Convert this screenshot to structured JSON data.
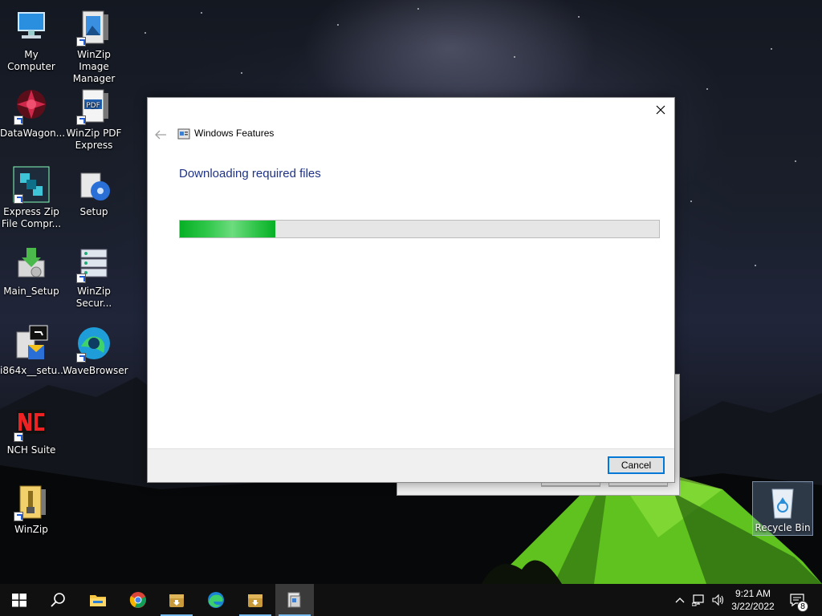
{
  "desktop": {
    "icons": [
      {
        "label": "My Computer",
        "icon": "computer-icon"
      },
      {
        "label": "WinZip Image Manager",
        "icon": "winzip-image-manager-icon"
      },
      {
        "label": "DataWagon...",
        "icon": "datawagon-icon"
      },
      {
        "label": "WinZip PDF Express",
        "icon": "winzip-pdf-icon"
      },
      {
        "label": "Express Zip File Compr...",
        "icon": "express-zip-icon"
      },
      {
        "label": "Setup",
        "icon": "setup-icon"
      },
      {
        "label": "Main_Setup",
        "icon": "installer-icon"
      },
      {
        "label": "WinZip Secur...",
        "icon": "winzip-secure-icon"
      },
      {
        "label": "i864x__setu...",
        "icon": "setup-exe-icon"
      },
      {
        "label": "WaveBrowser",
        "icon": "wavebrowser-icon"
      },
      {
        "label": "NCH Suite",
        "icon": "nch-suite-icon"
      },
      {
        "label": "WinZip",
        "icon": "winzip-icon"
      }
    ],
    "recycle_bin": {
      "label": "Recycle Bin"
    }
  },
  "dialog": {
    "title": "Windows Features",
    "heading": "Downloading required files",
    "progress_fraction": 0.2,
    "cancel_label": "Cancel"
  },
  "taskbar": {
    "items": [
      "start-icon",
      "search-icon",
      "file-explorer-icon",
      "chrome-icon",
      "installer-box-icon",
      "edge-icon",
      "installer-box-icon",
      "windows-features-icon"
    ],
    "clock": {
      "time": "9:21 AM",
      "date": "3/22/2022"
    },
    "notification_count": "8"
  },
  "colors": {
    "accent": "#0078d7",
    "progress_green": "#06b025",
    "heading_blue": "#1e3287"
  }
}
